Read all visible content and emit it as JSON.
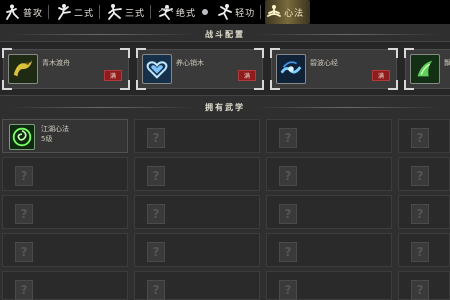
{
  "tabs": [
    {
      "label": "普攻",
      "icon": "fighter-pose-icon"
    },
    {
      "label": "二式",
      "icon": "kick-pose-icon"
    },
    {
      "label": "三式",
      "icon": "lunge-pose-icon"
    },
    {
      "label": "绝式",
      "icon": "spin-pose-icon"
    },
    {
      "label": "轻功",
      "icon": "leap-pose-icon"
    },
    {
      "label": "心法",
      "icon": "meditate-pose-icon",
      "active": true
    }
  ],
  "battle": {
    "title": "战斗配置",
    "slots": [
      {
        "name": "青木渡舟",
        "badge": "满",
        "icon": "yellow-dragon-icon",
        "color": "#c9b23a"
      },
      {
        "name": "养心销木",
        "badge": "满",
        "icon": "heart-icon",
        "color": "#9fd7ff"
      },
      {
        "name": "碧波心经",
        "badge": "满",
        "icon": "wave-icon",
        "color": "#4aa9ff"
      },
      {
        "name": "飘山",
        "badge": "",
        "icon": "green-wind-icon",
        "color": "#5fd05a"
      }
    ]
  },
  "owned": {
    "title": "拥有武学",
    "first": {
      "name": "江湖心法",
      "level": "5级",
      "icon": "green-spiral-icon",
      "color": "#7cff62"
    },
    "placeholder": "?"
  },
  "colors": {
    "full_badge": "#8e1c1c",
    "tab_active": "#7a6a3c"
  }
}
